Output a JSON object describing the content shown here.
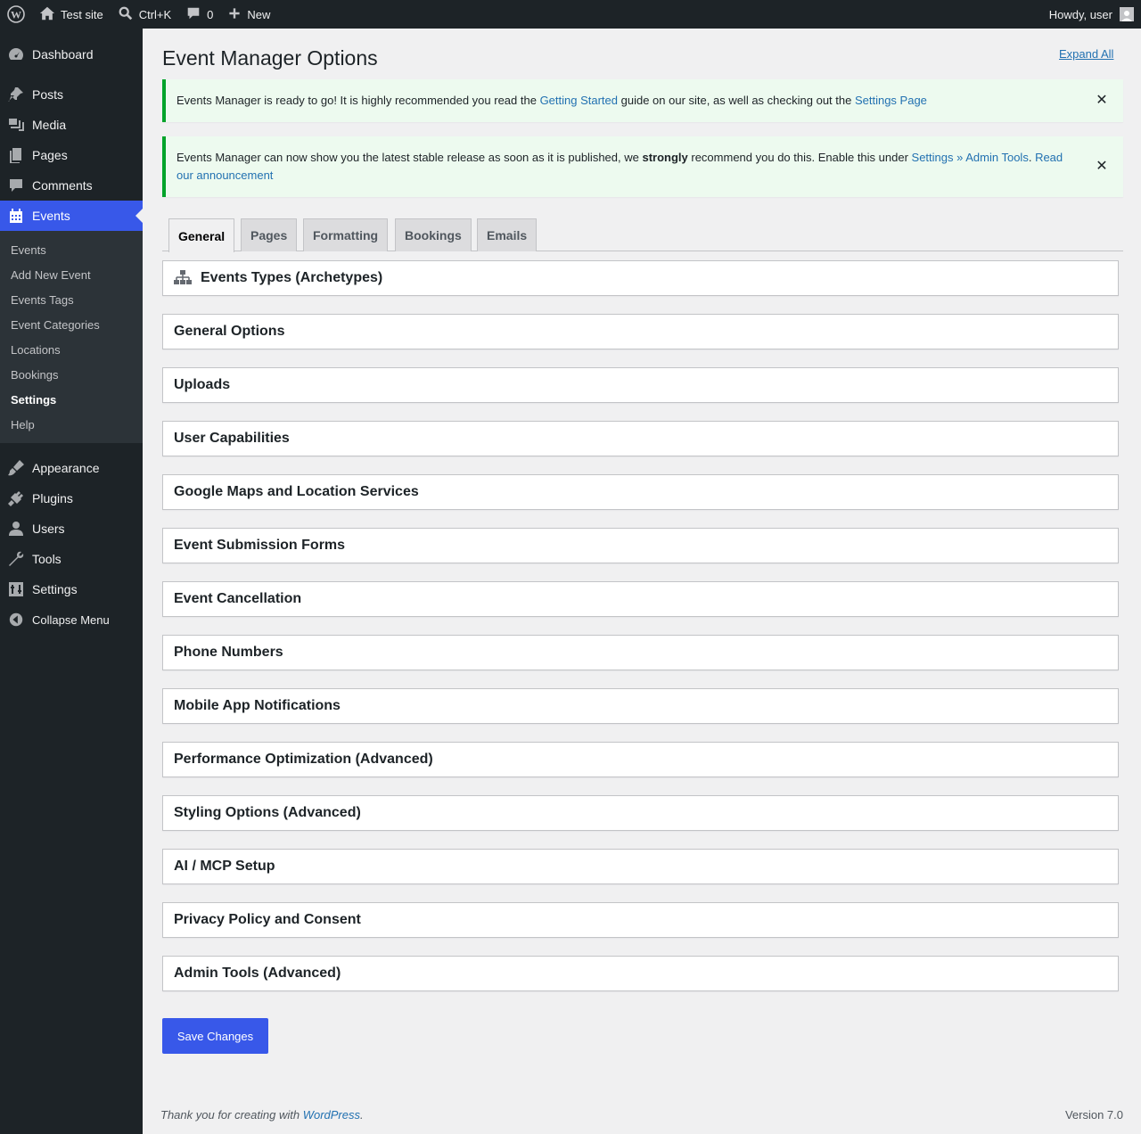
{
  "adminbar": {
    "site_name": "Test site",
    "search_shortcut": "Ctrl+K",
    "comments_count": "0",
    "new_label": "New",
    "howdy": "Howdy, user"
  },
  "sidebar": {
    "items": [
      {
        "label": "Dashboard",
        "icon": "dashboard-icon"
      },
      {
        "label": "Posts",
        "icon": "pin-icon"
      },
      {
        "label": "Media",
        "icon": "media-icon"
      },
      {
        "label": "Pages",
        "icon": "pages-icon"
      },
      {
        "label": "Comments",
        "icon": "comment-icon"
      },
      {
        "label": "Events",
        "icon": "calendar-icon"
      }
    ],
    "events_submenu": [
      "Events",
      "Add New Event",
      "Events Tags",
      "Event Categories",
      "Locations",
      "Bookings",
      "Settings",
      "Help"
    ],
    "lower_items": [
      {
        "label": "Appearance",
        "icon": "brush-icon"
      },
      {
        "label": "Plugins",
        "icon": "plug-icon"
      },
      {
        "label": "Users",
        "icon": "user-icon"
      },
      {
        "label": "Tools",
        "icon": "wrench-icon"
      },
      {
        "label": "Settings",
        "icon": "settings-icon"
      }
    ],
    "collapse_label": "Collapse Menu"
  },
  "main": {
    "title": "Event Manager Options",
    "expand_all": "Expand All",
    "notice1": {
      "text_a": "Events Manager is ready to go! It is highly recommended you read the ",
      "link_a": "Getting Started",
      "text_b": " guide on our site, as well as checking out the ",
      "link_b": "Settings Page"
    },
    "notice2": {
      "text_a": "Events Manager can now show you the latest stable release as soon as it is published, we ",
      "strong": "strongly",
      "text_b": " recommend you do this. Enable this under ",
      "link_a": "Settings » Admin Tools",
      "text_c": ". ",
      "link_b": "Read our announcement"
    },
    "tabs": [
      "General",
      "Pages",
      "Formatting",
      "Bookings",
      "Emails"
    ],
    "sections": [
      "Events Types (Archetypes)",
      "General Options",
      "Uploads",
      "User Capabilities",
      "Google Maps and Location Services",
      "Event Submission Forms",
      "Event Cancellation",
      "Phone Numbers",
      "Mobile App Notifications",
      "Performance Optimization (Advanced)",
      "Styling Options (Advanced)",
      "AI / MCP Setup",
      "Privacy Policy and Consent",
      "Admin Tools (Advanced)"
    ],
    "save_label": "Save Changes"
  },
  "footer": {
    "thanks_a": "Thank you for creating with ",
    "thanks_link": "WordPress",
    "thanks_b": ".",
    "version": "Version 7.0"
  },
  "colors": {
    "accent": "#3858e9",
    "adminbar": "#1d2327",
    "notice_border": "#00a32a",
    "link": "#2271b1"
  }
}
